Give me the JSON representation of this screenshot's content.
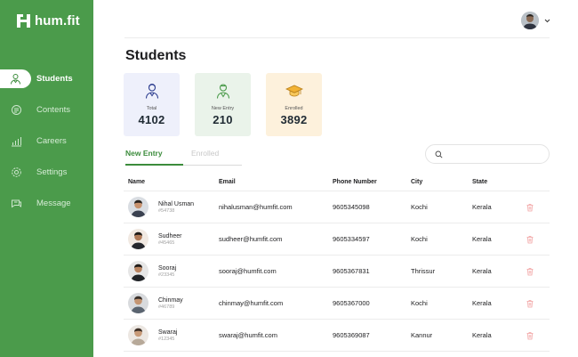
{
  "brand": {
    "name": "hum.fit",
    "color": "#4b9b4b"
  },
  "sidebar": {
    "items": [
      {
        "label": "Students",
        "icon": "student-icon",
        "active": true
      },
      {
        "label": "Contents",
        "icon": "contents-icon",
        "active": false
      },
      {
        "label": "Careers",
        "icon": "careers-chart-icon",
        "active": false
      },
      {
        "label": "Settings",
        "icon": "gear-icon",
        "active": false
      },
      {
        "label": "Message",
        "icon": "message-icon",
        "active": false
      }
    ]
  },
  "header": {
    "user_menu_icon": "chevron-down-icon"
  },
  "page": {
    "title": "Students"
  },
  "stats": [
    {
      "label": "Total",
      "value": "4102",
      "icon": "user-icon",
      "color": "#eef0fb"
    },
    {
      "label": "New Entry",
      "value": "210",
      "icon": "new-entry-user-icon",
      "color": "#eaf3ea"
    },
    {
      "label": "Enrolled",
      "value": "3892",
      "icon": "graduation-cap-icon",
      "color": "#fdf1dc"
    }
  ],
  "tabs": [
    {
      "label": "New Entry",
      "active": true
    },
    {
      "label": "Enrolled",
      "active": false
    }
  ],
  "search": {
    "placeholder": "",
    "value": ""
  },
  "table": {
    "columns": [
      "Name",
      "Email",
      "Phone Number",
      "City",
      "State"
    ],
    "rows": [
      {
        "name": "Nihal Usman",
        "id": "#54738",
        "email": "nihalusman@humfit.com",
        "phone": "9605345098",
        "city": "Kochi",
        "state": "Kerala"
      },
      {
        "name": "Sudheer",
        "id": "#45465",
        "email": "sudheer@humfit.com",
        "phone": "9605334597",
        "city": "Kochi",
        "state": "Kerala"
      },
      {
        "name": "Sooraj",
        "id": "#23345",
        "email": "sooraj@humfit.com",
        "phone": "9605367831",
        "city": "Thrissur",
        "state": "Kerala"
      },
      {
        "name": "Chinmay",
        "id": "#46789",
        "email": "chinmay@humfit.com",
        "phone": "9605367000",
        "city": "Kochi",
        "state": "Kerala"
      },
      {
        "name": "Swaraj",
        "id": "#12345",
        "email": "swaraj@humfit.com",
        "phone": "9605369087",
        "city": "Kannur",
        "state": "Kerala"
      }
    ]
  }
}
